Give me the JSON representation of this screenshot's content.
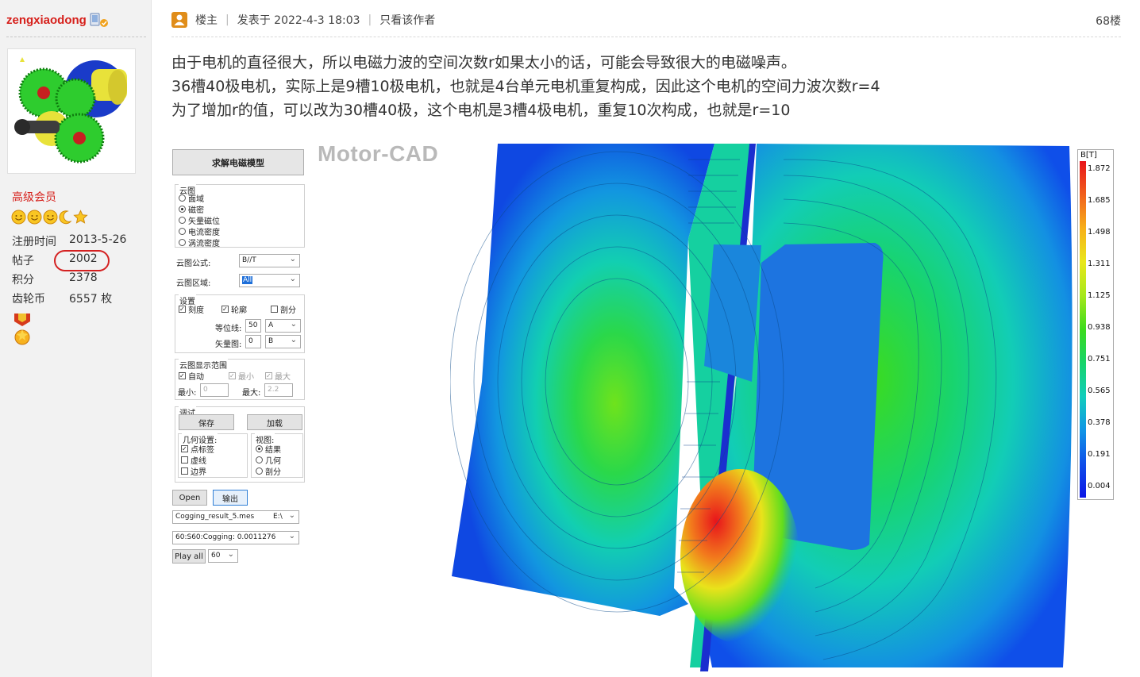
{
  "user": {
    "name": "zengxiaodong",
    "rank": "高级会员",
    "stats": [
      {
        "label": "注册时间",
        "value": "2013-5-26"
      },
      {
        "label": "帖子",
        "value": "2002"
      },
      {
        "label": "积分",
        "value": "2378"
      },
      {
        "label": "齿轮币",
        "value": "6557 枚"
      }
    ]
  },
  "post": {
    "author_tag": "楼主",
    "posted_at": "发表于 2022-4-3 18:03",
    "only_author": "只看该作者",
    "floor": "68楼",
    "lines": [
      "由于电机的直径很大，所以电磁力波的空间次数r如果太小的话，可能会导致很大的电磁噪声。",
      "36槽40极电机，实际上是9槽10极电机，也就是4台单元电机重复构成，因此这个电机的空间力波次数r=4",
      "为了增加r的值，可以改为30槽40极，这个电机是3槽4极电机，重复10次构成，也就是r=10"
    ]
  },
  "screenshot": {
    "watermark": "Motor-CAD",
    "solve_button": "求解电磁模型",
    "cloud_group": {
      "title": "云图",
      "options": [
        "面域",
        "磁密",
        "矢量磁位",
        "电流密度",
        "涡流密度"
      ],
      "selected": "磁密"
    },
    "formula_label": "云图公式:",
    "formula_value": "B//T",
    "region_label": "云图区域:",
    "region_value": "All",
    "settings": {
      "title": "设置",
      "scale": "刻度",
      "contour": "轮廓",
      "section": "剖分",
      "equipotential_label": "等位线:",
      "equipotential_value": "50",
      "equipotential_sel": "A",
      "vector_label": "矢量图:",
      "vector_value": "0",
      "vector_sel": "B"
    },
    "range": {
      "title": "云图显示范围",
      "auto": "自动",
      "min_chk": "最小",
      "max_chk": "最大",
      "min_label": "最小:",
      "min_value": "0",
      "max_label": "最大:",
      "max_value": "2.2"
    },
    "debug": {
      "title": "调试",
      "save": "保存",
      "load": "加载",
      "geom_title": "几何设置:",
      "geom": [
        "点标签",
        "虚线",
        "边界"
      ],
      "view_title": "视图:",
      "view": [
        "结果",
        "几何",
        "剖分"
      ],
      "view_selected": "结果"
    },
    "open_button": "Open",
    "export_button": "输出",
    "file_value": "Cogging_result_5.mes",
    "file_path": "E:\\",
    "result_value": "60:S60:Cogging: 0.0011276",
    "play_button": "Play all",
    "play_value": "60",
    "legend_title": "B[T]",
    "legend_ticks": [
      "1.872",
      "1.685",
      "1.498",
      "1.311",
      "1.125",
      "0.938",
      "0.751",
      "0.565",
      "0.378",
      "0.191",
      "0.004"
    ]
  },
  "colors": {
    "username": "#d6201b",
    "highlight": "#d42020",
    "louzhu": "#e08d1a"
  }
}
